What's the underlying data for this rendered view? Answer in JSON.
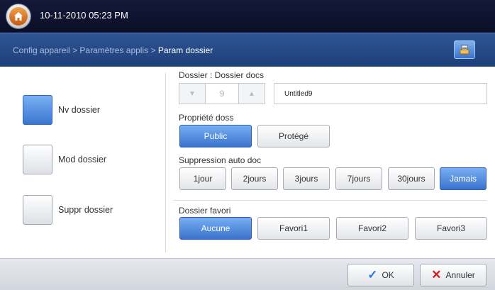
{
  "header": {
    "datetime": "10-11-2010 05:23 PM"
  },
  "breadcrumb": {
    "part1": "Config appareil",
    "sep": ">",
    "part2": "Paramètres applis",
    "current": "Param dossier"
  },
  "left_options": [
    {
      "label": "Nv dossier",
      "active": true
    },
    {
      "label": "Mod dossier",
      "active": false
    },
    {
      "label": "Suppr dossier",
      "active": false
    }
  ],
  "folder": {
    "label": "Dossier : Dossier docs",
    "number": "9",
    "name": "Untitled9"
  },
  "property": {
    "label": "Propriété doss",
    "options": [
      "Public",
      "Protégé"
    ],
    "selected": "Public"
  },
  "auto_delete": {
    "label": "Suppression auto doc",
    "options": [
      "1jour",
      "2jours",
      "3jours",
      "7jours",
      "30jours",
      "Jamais"
    ],
    "selected": "Jamais"
  },
  "favorite": {
    "label": "Dossier favori",
    "options": [
      "Aucune",
      "Favori1",
      "Favori2",
      "Favori3"
    ],
    "selected": "Aucune"
  },
  "actions": {
    "ok": "OK",
    "cancel": "Annuler"
  },
  "colors": {
    "accent": "#3a76d0",
    "header": "#0f1430",
    "crumbbar": "#2a4f8e",
    "cancel": "#d11f1f"
  }
}
